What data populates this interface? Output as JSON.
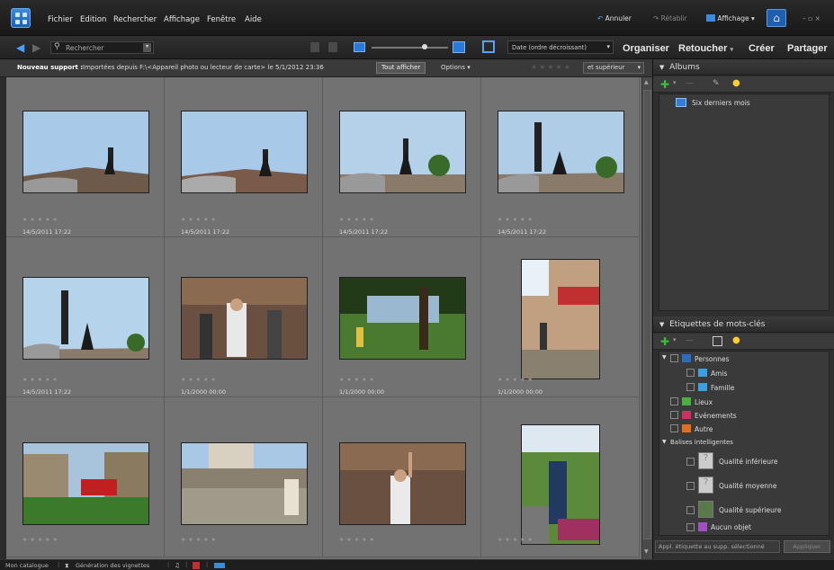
{
  "menu": {
    "items": [
      "Fichier",
      "Edition",
      "Rechercher",
      "Affichage",
      "Fenêtre",
      "Aide"
    ]
  },
  "topbar": {
    "undo": "Annuler",
    "redo": "Rétablir",
    "view": "Affichage",
    "win_controls": "– ▫ ×"
  },
  "toolbar": {
    "search": "Rechercher",
    "sort": "Date (ordre décroissant)",
    "tabs": [
      "Organiser",
      "Retoucher",
      "Créer",
      "Partager"
    ]
  },
  "infobar": {
    "source_label": "Nouveau support :",
    "source_text": "Importées depuis F:\\<Appareil photo ou lecteur de carte> le 5/1/2012 23:36",
    "show_all": "Tout afficher",
    "options": "Options",
    "rating_filter": "et supérieur"
  },
  "photos": [
    {
      "date": "14/5/2011 17:22",
      "stars": "★★★★★"
    },
    {
      "date": "14/5/2011 17:22",
      "stars": "★★★★★"
    },
    {
      "date": "14/5/2011 17:22",
      "stars": "★★★★★"
    },
    {
      "date": "14/5/2011 17:22",
      "stars": "★★★★★"
    },
    {
      "date": "14/5/2011 17:22",
      "stars": "★★★★★"
    },
    {
      "date": "1/1/2000 00:00",
      "stars": "★★★★★"
    },
    {
      "date": "1/1/2000 00:00",
      "stars": "★★★★★"
    },
    {
      "date": "1/1/2000 00:00",
      "stars": "★★★★★"
    },
    {
      "date": "",
      "stars": "★★★★★"
    },
    {
      "date": "",
      "stars": "★★★★★"
    },
    {
      "date": "",
      "stars": "★★★★★"
    },
    {
      "date": "",
      "stars": "★★★★★"
    }
  ],
  "albums": {
    "title": "Albums",
    "items": [
      "Six derniers mois"
    ]
  },
  "keywords": {
    "title": "Etiquettes de mots-clés",
    "items": [
      "Personnes",
      "Amis",
      "Famille",
      "Lieux",
      "Evénements",
      "Autre",
      "Balises intelligentes",
      "Qualité inférieure",
      "Qualité moyenne",
      "Qualité supérieure",
      "Aucun objet"
    ]
  },
  "apply": {
    "field": "Appl. étiquette au supp. sélectionné",
    "button": "Appliquer"
  },
  "statusbar": {
    "catalog": "Mon catalogue",
    "thumbs": "Génération des vignettes"
  },
  "colors": {
    "accent": "#3b8be0",
    "bg": "#2b2b2b",
    "grid": "#6e6e6e"
  }
}
